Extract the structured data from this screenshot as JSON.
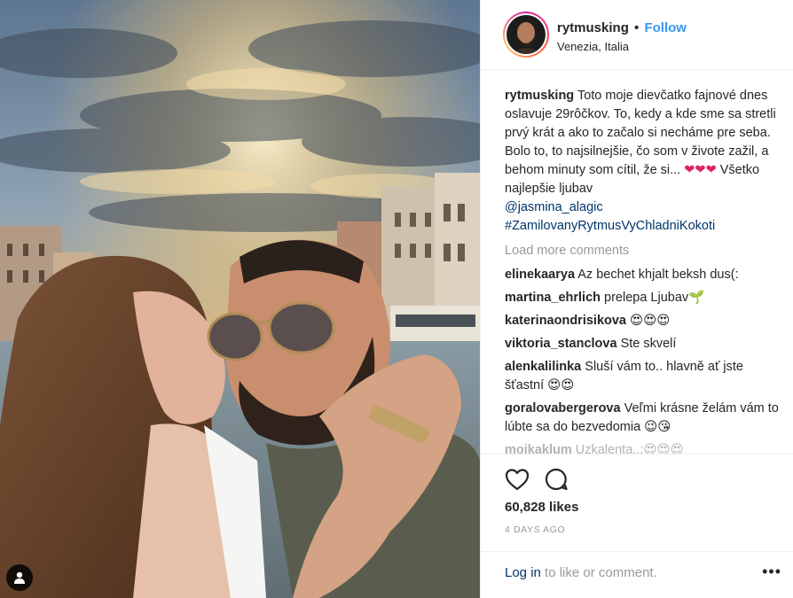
{
  "post": {
    "photo": {
      "description_icon": "person-tag-icon"
    },
    "header": {
      "username": "rytmusking",
      "separator": "•",
      "follow_label": "Follow",
      "location": "Venezia, Italia"
    },
    "caption": {
      "username": "rytmusking",
      "text": "Toto moje dievčatko fajnové dnes oslavuje 29rôčkov. To, kedy a kde sme sa stretli prvý krát a ako to začalo si necháme pre seba. Bolo to, to najsilnejšie, čo som v živote zažil, a behom minuty som cítil, že si...",
      "hearts": "❤❤❤",
      "text_after": "Všetko najlepšie ljubav",
      "mention": "@jasmina_alagic",
      "hashtag": "#ZamilovanyRytmusVyChladniKokoti"
    },
    "load_more_label": "Load more comments",
    "comments": [
      {
        "username": "elinekaarya",
        "text": "Az bechet khjalt beksh dus(:"
      },
      {
        "username": "martina_ehrlich",
        "text": "prelepa Ljubav🌱"
      },
      {
        "username": "katerinaondrisikova",
        "text": "😍😍😍"
      },
      {
        "username": "viktoria_stanclova",
        "text": "Ste skvelí"
      },
      {
        "username": "alenkalilinka",
        "text": "Sluší vám to.. hlavně ať jste šťastní 😍😍"
      },
      {
        "username": "goralovabergerova",
        "text": "Veľmi krásne želám vám to lúbte sa do bezvedomia 😉😘"
      },
      {
        "username": "mojkaklum",
        "text": "Uzkalenta..:😍😍😍"
      }
    ],
    "actions": {
      "like_icon": "heart-outline-icon",
      "comment_icon": "comment-bubble-icon",
      "likes": "60,828 likes",
      "time": "4 DAYS AGO"
    },
    "login": {
      "link": "Log in",
      "rest": "to like or comment.",
      "more": "•••"
    },
    "colors": {
      "link_blue": "#3897f0",
      "dark_link": "#003569",
      "muted": "#999999",
      "border": "#efefef"
    }
  }
}
